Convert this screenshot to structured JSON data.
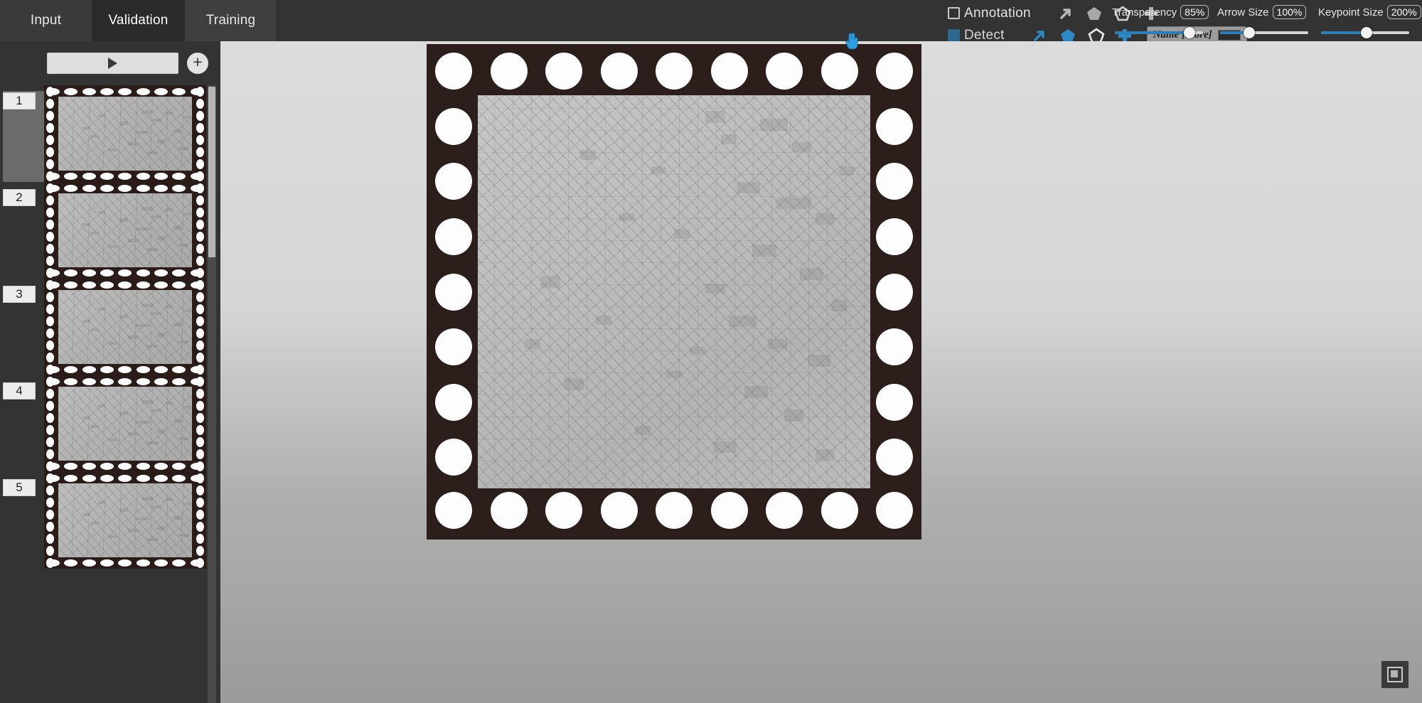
{
  "tabs": [
    {
      "label": "Input",
      "active": false
    },
    {
      "label": "Validation",
      "active": true
    },
    {
      "label": "Training",
      "active": false
    }
  ],
  "left_panel": {
    "play_button_label": "",
    "play_icon": "play-triangle-icon",
    "add_button_label": "+",
    "frames": [
      {
        "number": "1",
        "selected": true
      },
      {
        "number": "2",
        "selected": false
      },
      {
        "number": "3",
        "selected": false
      },
      {
        "number": "4",
        "selected": false
      },
      {
        "number": "5",
        "selected": false
      }
    ]
  },
  "toolbar": {
    "annotation": {
      "label": "Annotation",
      "checked": false,
      "tools": [
        {
          "name": "arrow-tool-icon",
          "glyph": "arrow"
        },
        {
          "name": "filled-polygon-tool-icon",
          "glyph": "polygon-filled"
        },
        {
          "name": "outline-polygon-tool-icon",
          "glyph": "polygon-outline"
        },
        {
          "name": "keypoint-tool-icon",
          "glyph": "cross"
        }
      ]
    },
    "detect": {
      "label": "Detect",
      "checked": true,
      "tools": [
        {
          "name": "arrow-detect-icon",
          "glyph": "arrow"
        },
        {
          "name": "filled-polygon-detect-icon",
          "glyph": "polygon-filled"
        },
        {
          "name": "outline-polygon-detect-icon",
          "glyph": "polygon-outline"
        },
        {
          "name": "keypoint-detect-icon",
          "glyph": "cross"
        }
      ],
      "name_tag_label": "Name [score]",
      "color_swatch": "#2b2b2b"
    },
    "sliders": [
      {
        "title": "Transparency",
        "value": "85%",
        "percent": 85
      },
      {
        "title": "Arrow Size",
        "value": "100%",
        "percent": 33
      },
      {
        "title": "Keypoint Size",
        "value": "200%",
        "percent": 52
      }
    ]
  },
  "viewer": {
    "fit_button": "fit-to-view-button",
    "image_description": "bga-chip-package-image"
  },
  "colors": {
    "accent": "#2e7fb5",
    "panel_bg": "#333333",
    "tab_active": "#2b2b2b",
    "substrate": "#2c1f1b",
    "ball": "#fdfdfd"
  }
}
